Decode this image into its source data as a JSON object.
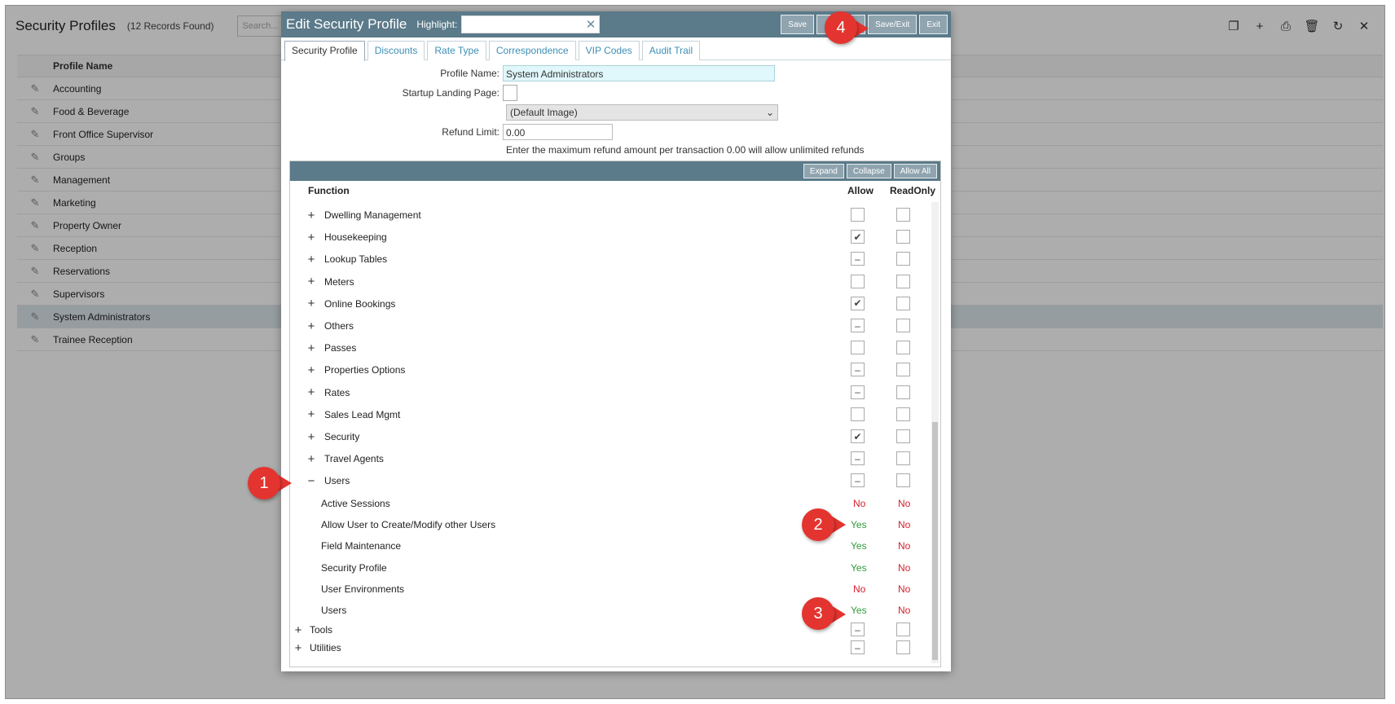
{
  "background": {
    "title": "Security Profiles",
    "record_count": "(12 Records Found)",
    "search_placeholder": "Search...",
    "column_header": "Profile Name",
    "profiles": [
      "Accounting",
      "Food & Beverage",
      "Front Office Supervisor",
      "Groups",
      "Management",
      "Marketing",
      "Property Owner",
      "Reception",
      "Reservations",
      "Supervisors",
      "System Administrators",
      "Trainee Reception"
    ],
    "selected_profile": "System Administrators"
  },
  "modal": {
    "title": "Edit Security Profile",
    "highlight_label": "Highlight:",
    "highlight_value": "",
    "buttons": {
      "save": "Save",
      "save_exit": "Save/Exit",
      "exit": "Exit"
    },
    "tabs": [
      "Security Profile",
      "Discounts",
      "Rate Type",
      "Correspondence",
      "VIP Codes",
      "Audit Trail"
    ],
    "active_tab": "Security Profile",
    "form": {
      "profile_name_label": "Profile Name:",
      "profile_name_value": "System Administrators",
      "startup_label": "Startup Landing Page:",
      "image_select_value": "(Default Image)",
      "refund_label": "Refund Limit:",
      "refund_value": "0.00",
      "refund_hint": "Enter the maximum refund amount per transaction 0.00 will allow unlimited refunds"
    },
    "grid": {
      "buttons": {
        "expand": "Expand",
        "collapse": "Collapse",
        "allow_all": "Allow All"
      },
      "headers": {
        "function": "Function",
        "allow": "Allow",
        "readonly": "ReadOnly"
      },
      "functions": [
        {
          "name": "Dwelling Management",
          "allow": "empty",
          "readonly": "empty"
        },
        {
          "name": "Housekeeping",
          "allow": "checked",
          "readonly": "empty"
        },
        {
          "name": "Lookup Tables",
          "allow": "partial",
          "readonly": "empty"
        },
        {
          "name": "Meters",
          "allow": "empty",
          "readonly": "empty"
        },
        {
          "name": "Online Bookings",
          "allow": "checked",
          "readonly": "empty"
        },
        {
          "name": "Others",
          "allow": "partial",
          "readonly": "empty"
        },
        {
          "name": "Passes",
          "allow": "empty",
          "readonly": "empty"
        },
        {
          "name": "Properties Options",
          "allow": "partial",
          "readonly": "empty"
        },
        {
          "name": "Rates",
          "allow": "partial",
          "readonly": "empty"
        },
        {
          "name": "Sales Lead Mgmt",
          "allow": "empty",
          "readonly": "empty"
        },
        {
          "name": "Security",
          "allow": "checked",
          "readonly": "empty"
        },
        {
          "name": "Travel Agents",
          "allow": "partial",
          "readonly": "empty"
        },
        {
          "name": "Users",
          "allow": "partial",
          "readonly": "empty",
          "expanded": true
        }
      ],
      "user_children": [
        {
          "name": "Active Sessions",
          "allow": "No",
          "readonly": "No"
        },
        {
          "name": "Allow User to Create/Modify other Users",
          "allow": "Yes",
          "readonly": "No"
        },
        {
          "name": "Field Maintenance",
          "allow": "Yes",
          "readonly": "No"
        },
        {
          "name": "Security Profile",
          "allow": "Yes",
          "readonly": "No"
        },
        {
          "name": "User Environments",
          "allow": "No",
          "readonly": "No"
        },
        {
          "name": "Users",
          "allow": "Yes",
          "readonly": "No"
        }
      ],
      "top_level": [
        {
          "name": "Tools",
          "allow": "partial",
          "readonly": "empty"
        },
        {
          "name": "Utilities",
          "allow": "partial",
          "readonly": "empty"
        }
      ]
    }
  },
  "callouts": [
    "1",
    "2",
    "3",
    "4"
  ],
  "colors": {
    "header": "#5b7a8a",
    "button": "#8fa4af",
    "yes": "#2f9b3c",
    "no": "#d0202c",
    "callout": "#e3342f"
  }
}
